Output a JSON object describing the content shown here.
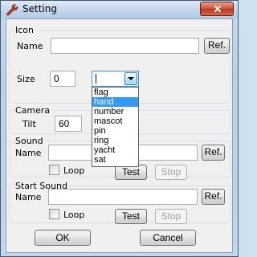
{
  "window": {
    "title": "Setting"
  },
  "icon_group": {
    "title": "Icon",
    "name_label": "Name",
    "name_value": "",
    "ref_label": "Ref.",
    "size_label": "Size",
    "size_value": "0",
    "combo_value": "",
    "dropdown_items": [
      "flag",
      "hand",
      "number",
      "mascot",
      "pin",
      "ring",
      "yacht",
      "sat"
    ],
    "selected_item": "hand"
  },
  "camera_group": {
    "title": "Camera",
    "tilt_label": "Tilt",
    "tilt_value": "60"
  },
  "sound_group": {
    "title": "Sound",
    "name_label": "Name",
    "name_value": "",
    "ref_label": "Ref.",
    "loop_label": "Loop",
    "test_label": "Test",
    "stop_label": "Stop"
  },
  "start_sound_group": {
    "title": "Start Sound",
    "name_label": "Name",
    "name_value": "",
    "ref_label": "Ref.",
    "loop_label": "Loop",
    "test_label": "Test",
    "stop_label": "Stop"
  },
  "buttons": {
    "ok_label": "OK",
    "cancel_label": "Cancel"
  },
  "icons": {
    "app": "wrench-icon",
    "close": "close-icon",
    "dropdown": "chevron-down-icon"
  },
  "colors": {
    "selection": "#3399ff",
    "close_button": "#c9462c"
  }
}
